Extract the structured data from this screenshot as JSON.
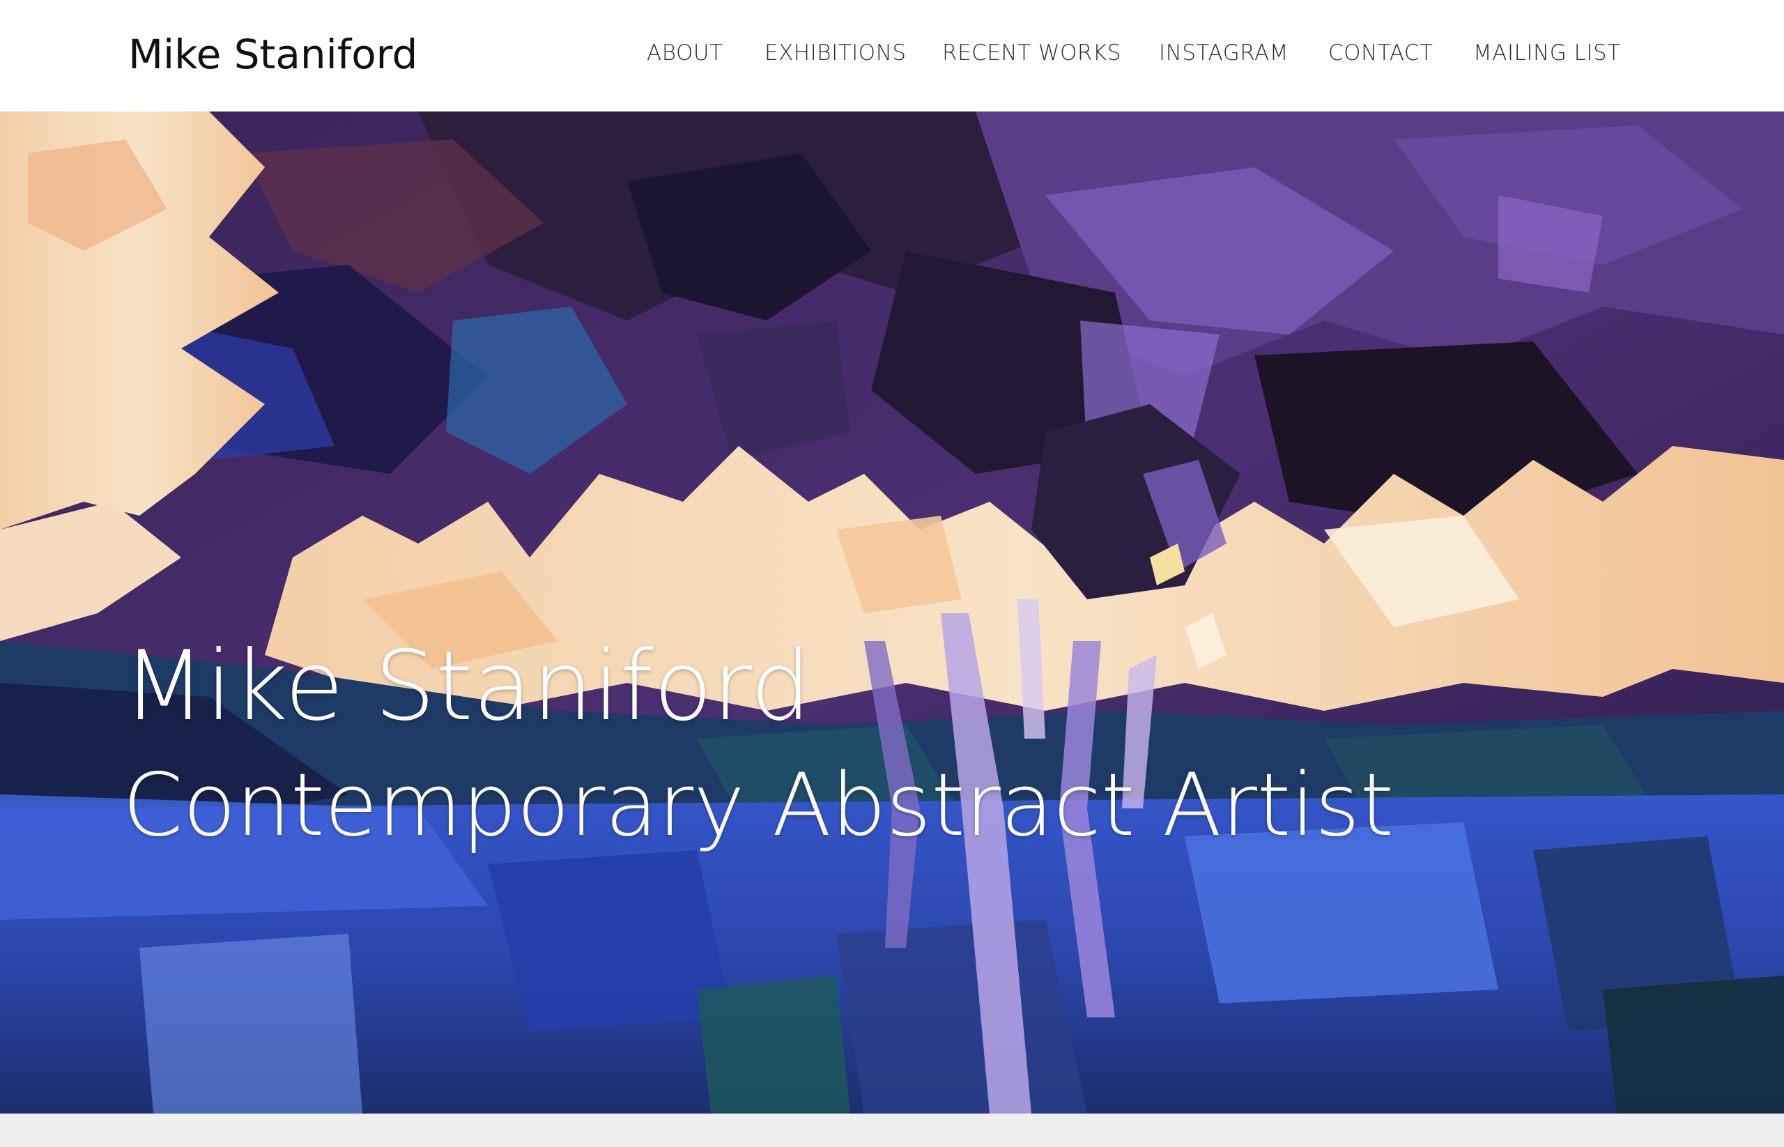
{
  "header": {
    "site_title": "Mike Staniford",
    "nav": [
      {
        "label": "ABOUT"
      },
      {
        "label": "EXHIBITIONS"
      },
      {
        "label": "RECENT WORKS"
      },
      {
        "label": "INSTAGRAM"
      },
      {
        "label": "CONTACT"
      },
      {
        "label": "MAILING LIST"
      }
    ]
  },
  "hero": {
    "title": "Mike Staniford",
    "subtitle": "Contemporary Abstract Artist",
    "image_description_colors": {
      "deep_purple": "#2a1a45",
      "violet": "#6a4a9e",
      "peach": "#f2c49a",
      "cream": "#f7e6cc",
      "blue": "#3d5fd6",
      "navy": "#16224a",
      "teal": "#1f4f66"
    }
  },
  "colors": {
    "header_bg": "#ffffff",
    "nav_text": "#2b2b2b",
    "title_text": "#111111",
    "hero_text": "#ffffff"
  }
}
